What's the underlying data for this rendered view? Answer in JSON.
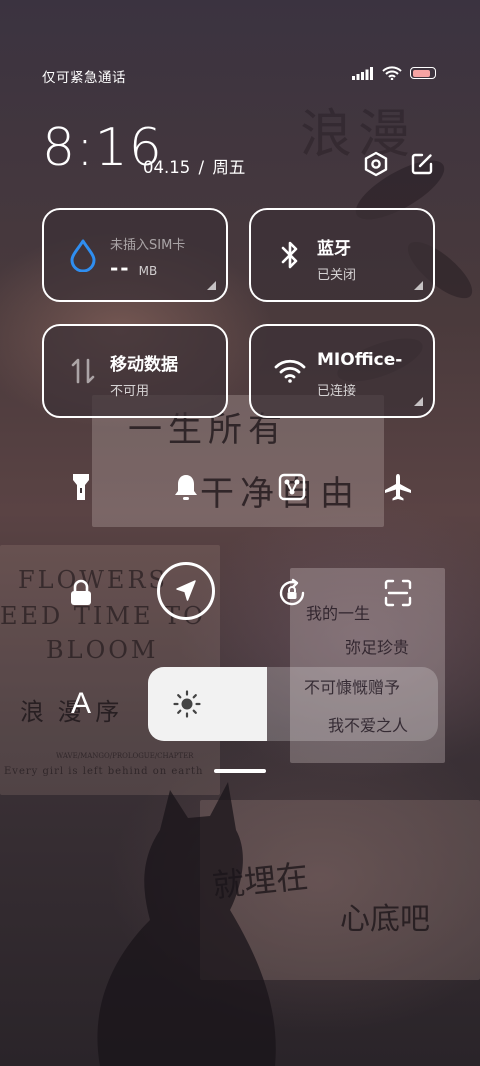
{
  "status_bar": {
    "carrier_text": "仅可紧急通话",
    "icons": [
      "signal-icon",
      "wifi-icon",
      "battery-icon"
    ],
    "battery_level": 0.85,
    "battery_color": "#f6a3a3"
  },
  "header": {
    "time": "8:16",
    "date": "04.15",
    "separator": "/",
    "weekday": "周五",
    "settings_icon": "settings-hexagon-icon",
    "edit_icon": "edit-icon"
  },
  "tiles": {
    "data": {
      "title": "未插入SIM卡",
      "value": "--",
      "unit": "MB",
      "icon": "water-drop-icon",
      "accent": "#2f8ef0"
    },
    "bluetooth": {
      "title": "蓝牙",
      "status": "已关闭",
      "icon": "bluetooth-icon"
    },
    "mobile_data": {
      "title": "移动数据",
      "status": "不可用",
      "icon": "mobile-data-arrows-icon"
    },
    "wifi": {
      "title": "MIOffice-",
      "status": "已连接",
      "icon": "wifi-icon"
    }
  },
  "toggles_row1": [
    "flashlight-icon",
    "bell-icon",
    "screen-cast-icon",
    "airplane-icon"
  ],
  "toggles_row2": [
    "lock-icon",
    "location-icon",
    "rotation-lock-icon",
    "scan-icon"
  ],
  "font_toggle": {
    "label": "A",
    "icon": "font-size-icon"
  },
  "brightness": {
    "level": 0.41,
    "icon": "sun-icon"
  },
  "wallpaper": {
    "line1": "一生所有",
    "line2": "干净自由",
    "flowers_1": "FLOWERS",
    "flowers_2": "EED TIME TO",
    "flowers_3": "BLOOM",
    "wave_title": "浪 漫 序",
    "wave_sub": "WAVE/MANGO/PROLOGUE/CHAPTER",
    "english_line": "Every girl is left behind on earth",
    "poem_1": "我的一生",
    "poem_2": "弥足珍贵",
    "poem_3": "不可慷慨赠予",
    "poem_4": "我不爱之人",
    "bottom_1": "就埋在",
    "bottom_2": "心底吧",
    "top_right": "浪漫"
  }
}
